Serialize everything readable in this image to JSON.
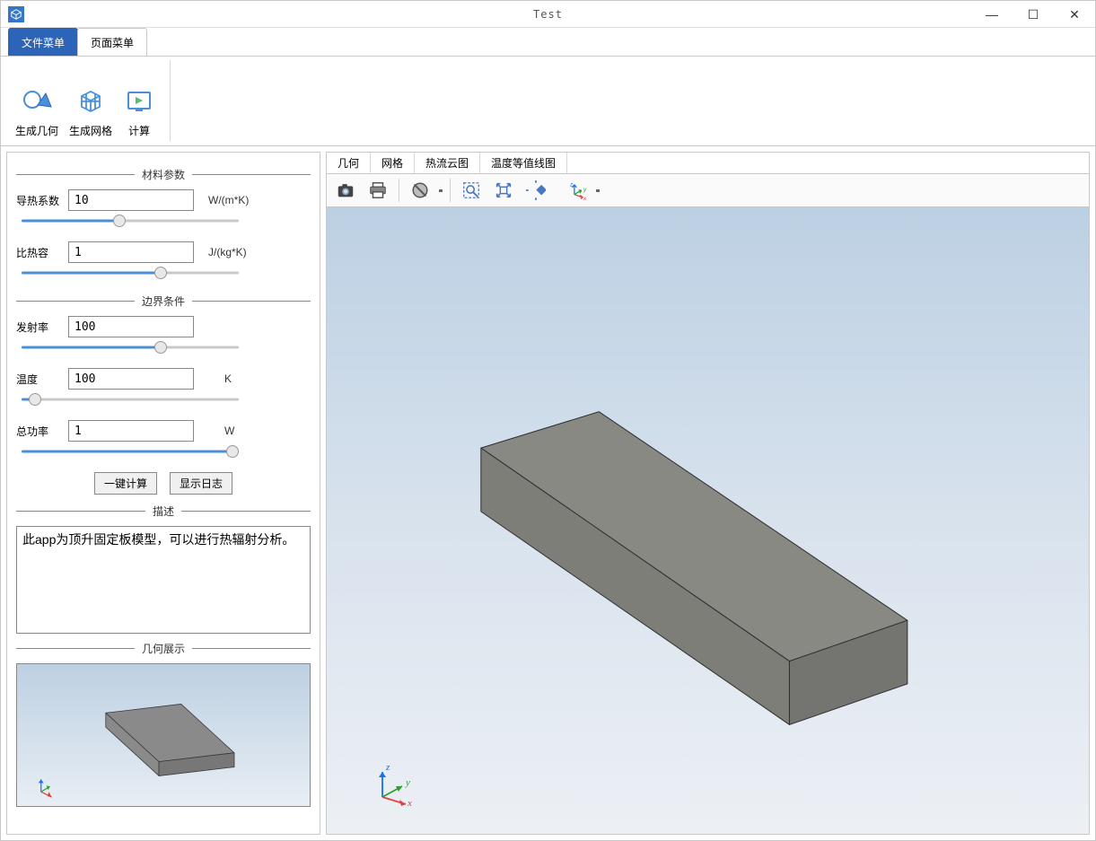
{
  "window": {
    "title": "Test"
  },
  "menus": {
    "file": "文件菜单",
    "page": "页面菜单"
  },
  "ribbon": {
    "gen_geom": "生成几何",
    "gen_mesh": "生成网格",
    "compute": "计算"
  },
  "sections": {
    "material": "材料参数",
    "boundary": "边界条件",
    "description": "描述",
    "geometry_display": "几何展示"
  },
  "params": {
    "conductivity": {
      "label": "导热系数",
      "value": "10",
      "unit": "W/(m*K)"
    },
    "specific_heat": {
      "label": "比热容",
      "value": "1",
      "unit": "J/(kg*K)"
    },
    "emissivity": {
      "label": "发射率",
      "value": "100",
      "unit": ""
    },
    "temperature": {
      "label": "温度",
      "value": "100",
      "unit": "K"
    },
    "total_power": {
      "label": "总功率",
      "value": "1",
      "unit": "W"
    }
  },
  "buttons": {
    "one_click_compute": "一键计算",
    "show_log": "显示日志"
  },
  "description_text": "此app为顶升固定板模型，可以进行热辐射分析。",
  "view_tabs": {
    "geometry": "几何",
    "mesh": "网格",
    "heat_flux_cloud": "热流云图",
    "temp_contour": "温度等值线图"
  },
  "axes": {
    "x": "x",
    "y": "y",
    "z": "z"
  }
}
